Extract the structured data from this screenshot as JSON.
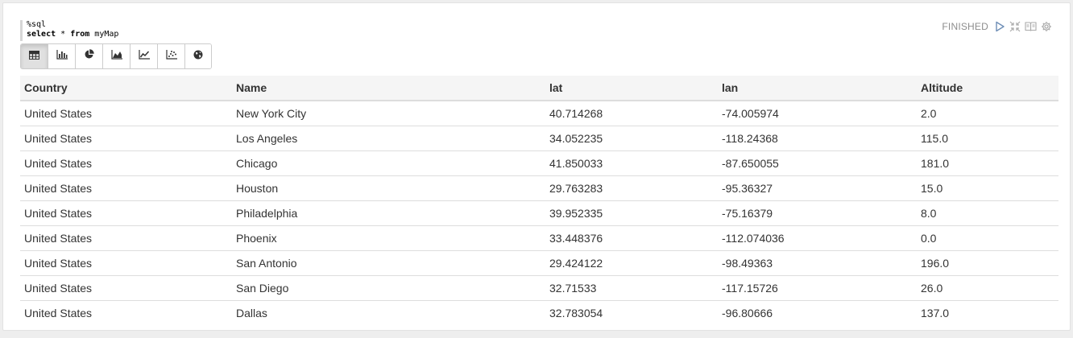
{
  "editor": {
    "line1": "%sql",
    "kw_select": "select",
    "star": " * ",
    "kw_from": "from",
    "table_name": " myMap"
  },
  "status": {
    "text": "FINISHED",
    "icons": [
      "run-icon",
      "collapse-icon",
      "book-icon",
      "gear-icon"
    ]
  },
  "toolbar": {
    "buttons": [
      "table-icon",
      "bar-chart-icon",
      "pie-chart-icon",
      "area-chart-icon",
      "line-chart-icon",
      "scatter-chart-icon",
      "globe-icon"
    ],
    "active": "table-icon"
  },
  "colors": {
    "icon": "#333333",
    "status_icon": "#6e8eb6",
    "status_muted": "#aaaaaa"
  },
  "table": {
    "headers": [
      "Country",
      "Name",
      "lat",
      "lan",
      "Altitude"
    ],
    "rows": [
      [
        "United States",
        "New York City",
        "40.714268",
        "-74.005974",
        "2.0"
      ],
      [
        "United States",
        "Los Angeles",
        "34.052235",
        "-118.24368",
        "115.0"
      ],
      [
        "United States",
        "Chicago",
        "41.850033",
        "-87.650055",
        "181.0"
      ],
      [
        "United States",
        "Houston",
        "29.763283",
        "-95.36327",
        "15.0"
      ],
      [
        "United States",
        "Philadelphia",
        "39.952335",
        "-75.16379",
        "8.0"
      ],
      [
        "United States",
        "Phoenix",
        "33.448376",
        "-112.074036",
        "0.0"
      ],
      [
        "United States",
        "San Antonio",
        "29.424122",
        "-98.49363",
        "196.0"
      ],
      [
        "United States",
        "San Diego",
        "32.71533",
        "-117.15726",
        "26.0"
      ],
      [
        "United States",
        "Dallas",
        "32.783054",
        "-96.80666",
        "137.0"
      ]
    ]
  }
}
